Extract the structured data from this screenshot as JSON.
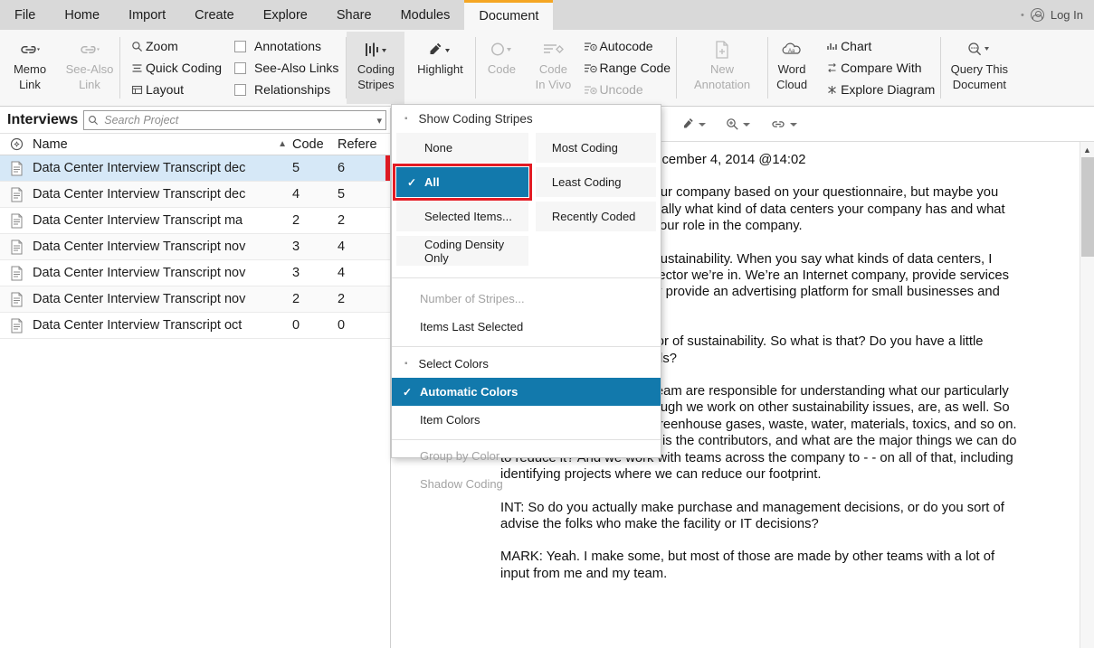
{
  "titlebar": {
    "tabs": [
      {
        "label": "File",
        "active": false
      },
      {
        "label": "Home",
        "active": false
      },
      {
        "label": "Import",
        "active": false
      },
      {
        "label": "Create",
        "active": false
      },
      {
        "label": "Explore",
        "active": false
      },
      {
        "label": "Share",
        "active": false
      },
      {
        "label": "Modules",
        "active": false
      },
      {
        "label": "Document",
        "active": true
      }
    ],
    "login_label": "Log In",
    "accent_color": "#f5a623"
  },
  "ribbon": {
    "links": {
      "memo_link": "Memo\nLink",
      "memo_link_line1": "Memo",
      "memo_link_line2": "Link",
      "see_also_line1": "See-Also",
      "see_also_line2": "Link"
    },
    "view_commands": [
      {
        "label": "Zoom",
        "icon": "magnifier-icon",
        "disabled": false
      },
      {
        "label": "Quick Coding",
        "icon": "lines-icon",
        "disabled": false
      },
      {
        "label": "Layout",
        "icon": "layout-icon",
        "disabled": false
      }
    ],
    "checkboxes": [
      {
        "label": "Annotations",
        "checked": false
      },
      {
        "label": "See-Also Links",
        "checked": false
      },
      {
        "label": "Relationships",
        "checked": false
      }
    ],
    "coding_stripes_line1": "Coding",
    "coding_stripes_line2": "Stripes",
    "highlight_label": "Highlight",
    "code_label": "Code",
    "code_invivo_line1": "Code",
    "code_invivo_line2": "In Vivo",
    "code_commands": [
      {
        "label": "Autocode",
        "disabled": false
      },
      {
        "label": "Range Code",
        "disabled": false
      },
      {
        "label": "Uncode",
        "disabled": true
      }
    ],
    "new_annotation_line1": "New",
    "new_annotation_line2": "Annotation",
    "word_cloud_line1": "Word",
    "word_cloud_line2": "Cloud",
    "explore_commands": [
      {
        "label": "Chart",
        "icon": "chart-icon"
      },
      {
        "label": "Compare With",
        "icon": "compare-icon"
      },
      {
        "label": "Explore Diagram",
        "icon": "diagram-icon"
      }
    ],
    "query_this_line1": "Query This",
    "query_this_line2": "Document"
  },
  "left_panel": {
    "title": "Interviews",
    "search_placeholder": "Search Project",
    "columns": {
      "name": "Name",
      "code": "Code",
      "reference": "Refere"
    },
    "rows": [
      {
        "name": "Data Center Interview Transcript dec",
        "code": "5",
        "reference": "6",
        "selected": true
      },
      {
        "name": "Data Center Interview Transcript dec",
        "code": "4",
        "reference": "5",
        "selected": false
      },
      {
        "name": "Data Center Interview Transcript ma",
        "code": "2",
        "reference": "2",
        "selected": false
      },
      {
        "name": "Data Center Interview Transcript nov",
        "code": "3",
        "reference": "4",
        "selected": false
      },
      {
        "name": "Data Center Interview Transcript nov",
        "code": "3",
        "reference": "4",
        "selected": false
      },
      {
        "name": "Data Center Interview Transcript nov",
        "code": "2",
        "reference": "2",
        "selected": false
      },
      {
        "name": "Data Center Interview Transcript oct",
        "code": "0",
        "reference": "0",
        "selected": false
      }
    ],
    "stripe_color": "#e01b24"
  },
  "coding_stripes_menu": {
    "header": "Show Coding Stripes",
    "left_options": [
      {
        "label": "None",
        "selected": false,
        "checked": false
      },
      {
        "label": "All",
        "selected": true,
        "checked": true,
        "outlined": true
      },
      {
        "label": "Selected Items...",
        "selected": false,
        "checked": false
      },
      {
        "label": "Coding Density Only",
        "selected": false,
        "checked": false
      }
    ],
    "right_options": [
      {
        "label": "Most Coding",
        "selected": false
      },
      {
        "label": "Least Coding",
        "selected": false
      },
      {
        "label": "Recently Coded",
        "selected": false
      }
    ],
    "middle_rows": [
      {
        "label": "Number of Stripes...",
        "disabled": true
      },
      {
        "label": "Items Last Selected",
        "disabled": false
      }
    ],
    "colors_header": "Select Colors",
    "color_rows": [
      {
        "label": "Automatic Colors",
        "selected": true,
        "checked": true
      },
      {
        "label": "Item Colors",
        "selected": false,
        "checked": false
      }
    ],
    "bottom_rows": [
      {
        "label": "Group by Color",
        "disabled": true
      },
      {
        "label": "Shadow Coding",
        "disabled": true
      }
    ],
    "highlight_color": "#1279ac",
    "outline_color": "#e31b23"
  },
  "document": {
    "paragraphs": [
      "Data Center Interview – December 4, 2014 @14:02",
      "INT:  I know a little about your company based on your questionnaire, but maybe you could start by tell me generally what kind of data centers your company has and what industries you serve, and your role in the company.",
      "MARK:  I’m the director of sustainability.  When you say what kinds of data centers, I guess it is just sort of the sector we’re in.  We’re an Internet company, provide services to consumers and basically provide an advertising platform for small businesses and others.",
      "INT:  So you said the director of sustainability.  So what is that?  Do you have a little definition of what that entails?",
      "MARK:  Sure.  Me and my team are responsible for understanding what our particularly environmental impacts, though we work on other sustainability issues, are, as well.  So across the board energy, greenhouse gases, waste, water, materials, toxics, and so on.  What’s our footprint?  What is the contributors, and what are the major things we can do to reduce it?  And we work with teams across the company to - - on all of that, including identifying projects where we can reduce our footprint.",
      "INT:  So do you actually make purchase and management decisions, or do you sort of advise the folks who make the facility or IT decisions?",
      "MARK:  Yeah.  I make some, but most of those are made by other teams with a lot of input from me and my team."
    ]
  }
}
